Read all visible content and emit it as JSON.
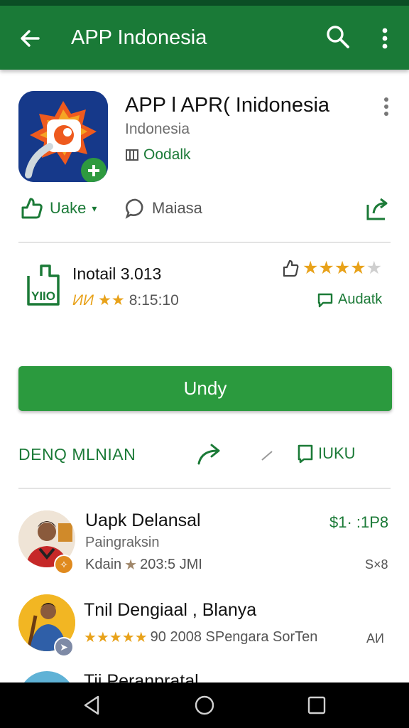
{
  "appbar": {
    "title": "APP Indonesia"
  },
  "app": {
    "name": "APP l APR( Inidonesia",
    "developer": "Indonesia",
    "tag": "Oodalk"
  },
  "actions": {
    "left_label": "Uake",
    "middle_label": "Maiasa"
  },
  "info": {
    "title": "Inotail 3.013",
    "rating_prefix": "ИИ",
    "rating_value": "8:15:10",
    "audit_label": "Audatk"
  },
  "install": {
    "label": "Undy"
  },
  "section": {
    "title": "DENQ MLNIAN",
    "right_label": "IUKU"
  },
  "list": [
    {
      "name": "Uapk Delansal",
      "sub": "Paingraksin",
      "meta": "Kdain",
      "meta_value": "203:5 JMI",
      "price": "$1· :1P8",
      "tail": "S×8"
    },
    {
      "name": "Tnil Dengiaal , Blanya",
      "meta_value": "90 2008 SPengara SorTen",
      "tail": "AИ"
    },
    {
      "name": "Tij Peranpratal"
    }
  ],
  "colors": {
    "primary": "#1a7a37",
    "button": "#2b9a3e",
    "star": "#e8a21a"
  },
  "icons": [
    "back-arrow-icon",
    "search-icon",
    "more-vert-icon",
    "share-icon",
    "thumb-icon",
    "home-icon",
    "recents-icon"
  ]
}
